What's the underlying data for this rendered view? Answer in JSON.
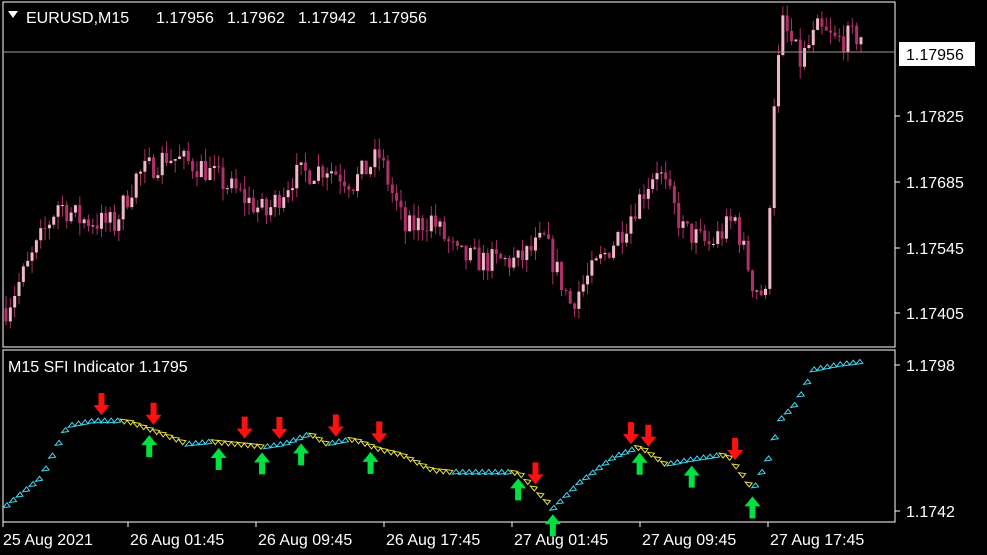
{
  "main_chart": {
    "symbol_info": "EURUSD,M15",
    "ohlc": [
      "1.17956",
      "1.17962",
      "1.17942",
      "1.17956"
    ],
    "current_price": "1.17956",
    "y_ticks": [
      "1.17825",
      "1.17685",
      "1.17545",
      "1.17405"
    ]
  },
  "sub_chart": {
    "title": "M15 SFI Indicator 1.1795",
    "y_ticks": [
      "1.1798",
      "1.1742"
    ]
  },
  "x_ticks": [
    "25 Aug 2021",
    "26 Aug 01:45",
    "26 Aug 09:45",
    "26 Aug 17:45",
    "27 Aug 01:45",
    "27 Aug 09:45",
    "27 Aug 17:45"
  ],
  "colors": {
    "background": "#000000",
    "candles": "#f0b8c8",
    "candle_dark": "#b0306a",
    "grid": "#ffffff",
    "up_trail": "#40d8f0",
    "down_trail": "#e8e040",
    "buy_arrow": "#00e040",
    "sell_arrow": "#ff1010"
  },
  "chart_data": [
    {
      "type": "candlestick",
      "title": "EURUSD,M15",
      "ylim": [
        1.1736,
        1.1801
      ],
      "close_profile": [
        [
          0,
          1.1743
        ],
        [
          5,
          1.1751
        ],
        [
          12,
          1.1763
        ],
        [
          17,
          1.176
        ],
        [
          25,
          1.1759
        ],
        [
          30,
          1.1768
        ],
        [
          37,
          1.1772
        ],
        [
          45,
          1.177
        ],
        [
          55,
          1.1764
        ],
        [
          60,
          1.1761
        ],
        [
          66,
          1.1768
        ],
        [
          74,
          1.177
        ],
        [
          80,
          1.1767
        ],
        [
          86,
          1.1772
        ],
        [
          92,
          1.1758
        ],
        [
          98,
          1.176
        ],
        [
          104,
          1.1753
        ],
        [
          110,
          1.1752
        ],
        [
          118,
          1.1752
        ],
        [
          124,
          1.1756
        ],
        [
          130,
          1.1744
        ],
        [
          136,
          1.1751
        ],
        [
          142,
          1.1758
        ],
        [
          150,
          1.177
        ],
        [
          156,
          1.1758
        ],
        [
          162,
          1.1755
        ],
        [
          168,
          1.176
        ],
        [
          172,
          1.1748
        ],
        [
          175,
          1.1745
        ],
        [
          177,
          1.1783
        ],
        [
          179,
          1.1797
        ],
        [
          183,
          1.179
        ],
        [
          187,
          1.1796
        ],
        [
          191,
          1.1794
        ],
        [
          197,
          1.1795
        ]
      ]
    },
    {
      "type": "line",
      "title": "M15 SFI Indicator 1.1795",
      "ylim": [
        1.1738,
        1.18
      ],
      "series": [
        {
          "values": [
            [
              0,
              1.1742
            ],
            [
              8,
              1.1753
            ],
            [
              14,
              1.1773
            ],
            [
              20,
              1.1775
            ],
            [
              28,
              1.1775
            ],
            [
              36,
              1.177
            ],
            [
              42,
              1.1766
            ],
            [
              48,
              1.1767
            ],
            [
              54,
              1.1766
            ],
            [
              60,
              1.1765
            ],
            [
              64,
              1.1766
            ],
            [
              70,
              1.177
            ],
            [
              74,
              1.1766
            ],
            [
              80,
              1.1768
            ],
            [
              86,
              1.1764
            ],
            [
              91,
              1.1762
            ],
            [
              98,
              1.1756
            ],
            [
              104,
              1.1755
            ],
            [
              112,
              1.1755
            ],
            [
              118,
              1.1755
            ],
            [
              126,
              1.1741
            ],
            [
              132,
              1.1751
            ],
            [
              140,
              1.1761
            ],
            [
              146,
              1.1765
            ],
            [
              152,
              1.1758
            ],
            [
              158,
              1.176
            ],
            [
              166,
              1.1762
            ],
            [
              170,
              1.1753
            ],
            [
              172,
              1.1748
            ],
            [
              176,
              1.1762
            ],
            [
              178,
              1.1775
            ],
            [
              182,
              1.1782
            ],
            [
              186,
              1.1795
            ],
            [
              192,
              1.1797
            ],
            [
              197,
              1.1798
            ]
          ]
        }
      ],
      "signals": [
        {
          "type": "sell",
          "x": 22
        },
        {
          "type": "sell",
          "x": 34
        },
        {
          "type": "buy",
          "x": 33
        },
        {
          "type": "buy",
          "x": 49
        },
        {
          "type": "sell",
          "x": 55
        },
        {
          "type": "buy",
          "x": 59
        },
        {
          "type": "sell",
          "x": 63
        },
        {
          "type": "buy",
          "x": 68
        },
        {
          "type": "sell",
          "x": 76
        },
        {
          "type": "buy",
          "x": 84
        },
        {
          "type": "sell",
          "x": 86
        },
        {
          "type": "buy",
          "x": 118
        },
        {
          "type": "sell",
          "x": 122
        },
        {
          "type": "buy",
          "x": 126
        },
        {
          "type": "sell",
          "x": 144
        },
        {
          "type": "buy",
          "x": 146
        },
        {
          "type": "sell",
          "x": 148
        },
        {
          "type": "buy",
          "x": 158
        },
        {
          "type": "sell",
          "x": 168
        },
        {
          "type": "buy",
          "x": 172
        }
      ]
    }
  ]
}
